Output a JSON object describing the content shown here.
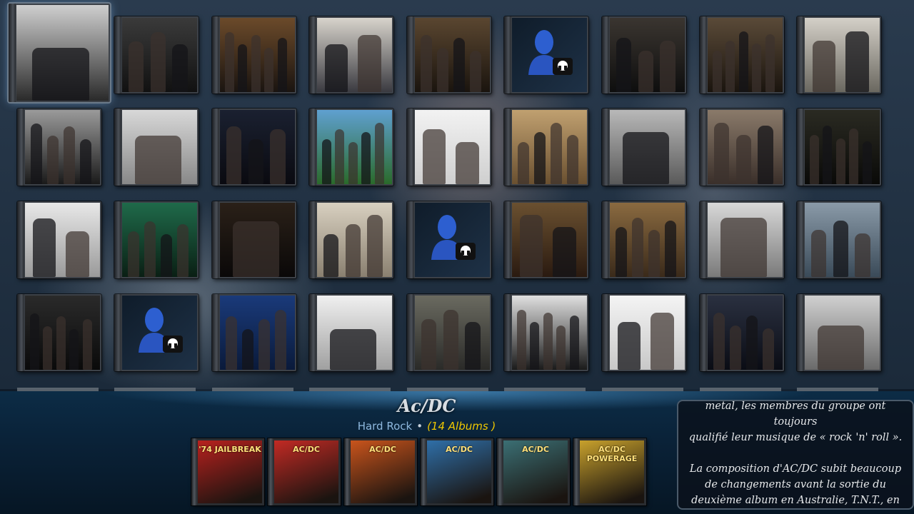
{
  "artist": {
    "name": "Ac/DC",
    "genre": "Hard Rock",
    "separator": "•",
    "album_count": "(14 Albums )"
  },
  "albums": [
    {
      "label": "'74 JAILBREAK",
      "accent": "#b8211e"
    },
    {
      "label": "AC/DC",
      "accent": "#c22a24"
    },
    {
      "label": "AC/DC",
      "accent": "#c9541c"
    },
    {
      "label": "AC/DC",
      "accent": "#2f6fa8"
    },
    {
      "label": "AC/DC",
      "accent": "#3b6f74"
    },
    {
      "label": "AC/DC POWERAGE",
      "accent": "#c8a12c"
    }
  ],
  "biography": "metal, les membres du groupe ont toujours\nqualifié leur musique de « rock 'n' roll ».\n\nLa composition d'AC/DC subit beaucoup\nde changements avant la sortie du\ndeuxième album en Australie, T.N.T., en",
  "colors": {
    "genre": "#8eb8de",
    "album_count": "#f0c800",
    "artist_name": "#d8dde2"
  },
  "grid_icons": "person-headphones-icon"
}
